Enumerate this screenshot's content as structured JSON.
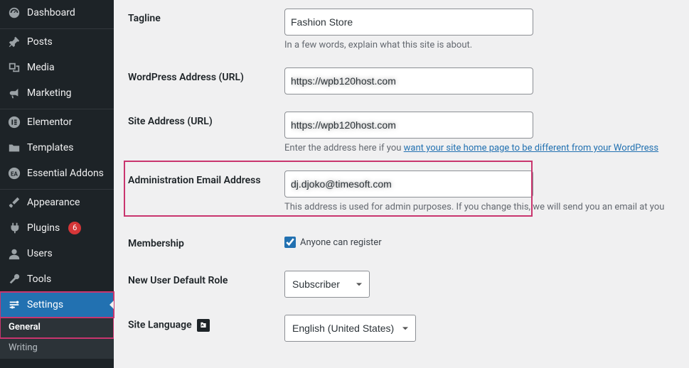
{
  "sidebar": {
    "items": [
      {
        "label": "Dashboard"
      },
      {
        "label": "Posts"
      },
      {
        "label": "Media"
      },
      {
        "label": "Marketing"
      },
      {
        "label": "Elementor"
      },
      {
        "label": "Templates"
      },
      {
        "label": "Essential Addons"
      },
      {
        "label": "Appearance"
      },
      {
        "label": "Plugins",
        "badge": "6"
      },
      {
        "label": "Users"
      },
      {
        "label": "Tools"
      },
      {
        "label": "Settings"
      }
    ],
    "submenu": [
      {
        "label": "General"
      },
      {
        "label": "Writing"
      }
    ]
  },
  "form": {
    "tagline": {
      "label": "Tagline",
      "value": "Fashion Store",
      "help": "In a few words, explain what this site is about."
    },
    "wpurl": {
      "label": "WordPress Address (URL)",
      "value": "https://wpb120host.com"
    },
    "siteurl": {
      "label": "Site Address (URL)",
      "value": "https://wpb120host.com",
      "help_pre": "Enter the address here if you ",
      "help_link": "want your site home page to be different from your WordPress"
    },
    "adminemail": {
      "label": "Administration Email Address",
      "value": "dj.djoko@timesoft.com",
      "help": "This address is used for admin purposes. If you change this, we will send you an email at you"
    },
    "membership": {
      "label": "Membership",
      "cb_label": "Anyone can register"
    },
    "defaultrole": {
      "label": "New User Default Role",
      "value": "Subscriber"
    },
    "language": {
      "label": "Site Language",
      "value": "English (United States)"
    }
  }
}
